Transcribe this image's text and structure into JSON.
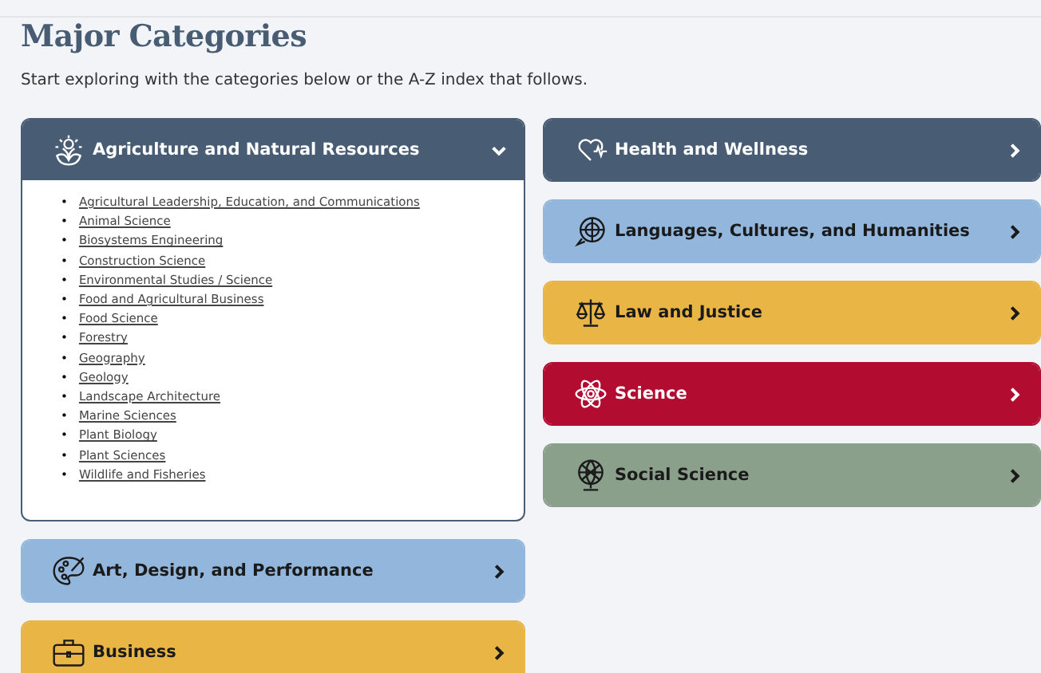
{
  "heading": "Major Categories",
  "intro": "Start exploring with the categories below or the A-Z index that follows.",
  "columns": [
    {
      "categories": [
        {
          "label": "Agriculture and Natural Resources",
          "color": "#485d73",
          "expanded": true,
          "bullet": "•",
          "links": [
            "Agricultural Leadership, Education, and Communications",
            "Animal Science",
            "Biosystems Engineering",
            "Construction Science",
            "Environmental Studies / Science",
            "Food and Agricultural Business",
            "Food Science",
            "Forestry",
            "Geography",
            "Geology",
            "Landscape Architecture",
            "Marine Sciences",
            "Plant Biology",
            "Plant Sciences",
            "Wildlife and Fisheries"
          ]
        },
        {
          "label": "Art, Design, and Performance",
          "color": "#93b7dc",
          "expanded": false
        },
        {
          "label": "Business",
          "color": "#e9b545",
          "expanded": false
        }
      ]
    },
    {
      "categories": [
        {
          "label": "Health and Wellness",
          "color": "#485d73",
          "expanded": false
        },
        {
          "label": "Languages, Cultures, and Humanities",
          "color": "#93b7dc",
          "expanded": false
        },
        {
          "label": "Law and Justice",
          "color": "#e9b545",
          "expanded": false
        },
        {
          "label": "Science",
          "color": "#b20d30",
          "expanded": false
        },
        {
          "label": "Social Science",
          "color": "#8ba08a",
          "expanded": false
        }
      ]
    }
  ]
}
